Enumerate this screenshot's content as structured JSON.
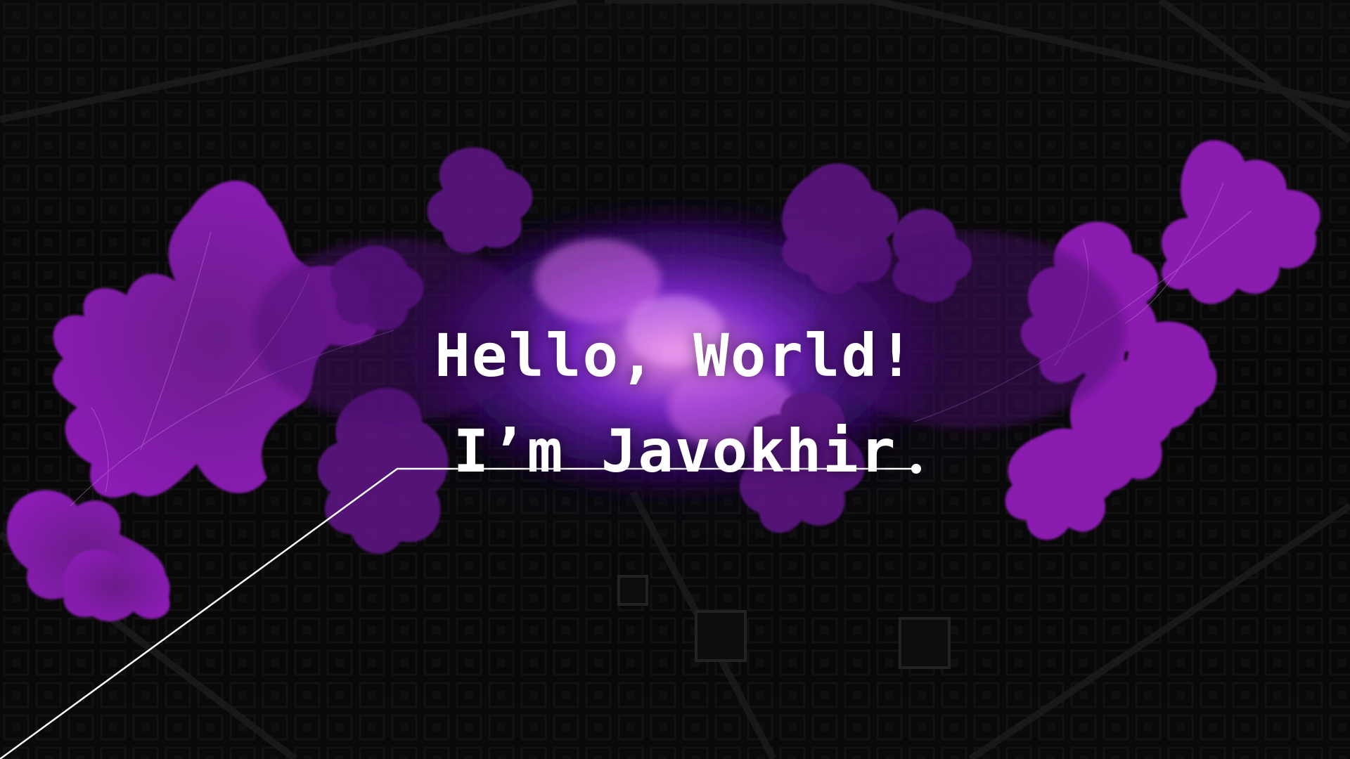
{
  "hero": {
    "greeting": "Hello, World!",
    "intro": "I’m Javokhir"
  },
  "colors": {
    "background": "#060606",
    "accent_purple": "#8a1fb0",
    "glow": "#7b2ff7",
    "text": "#ffffff"
  }
}
